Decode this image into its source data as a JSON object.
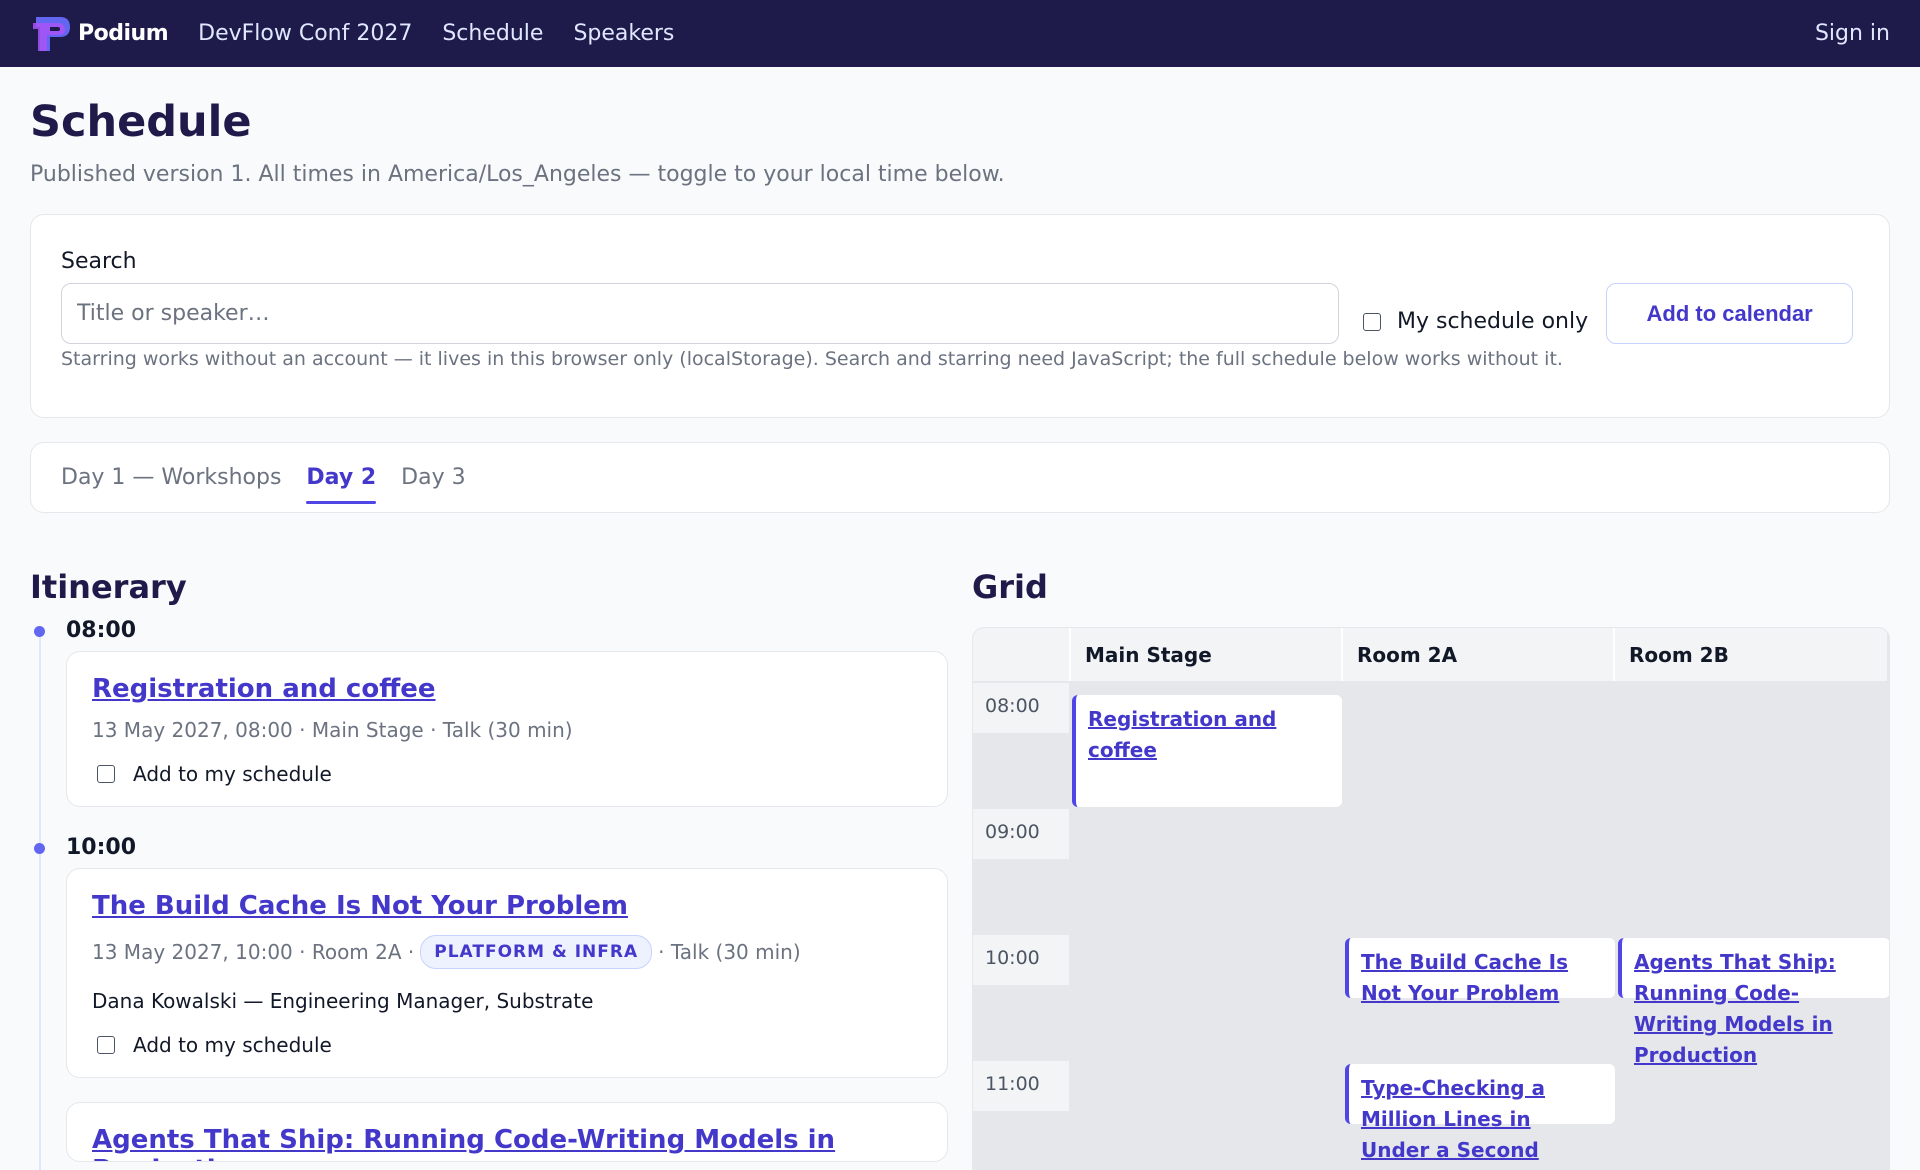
{
  "nav": {
    "brand": "Podium",
    "links": [
      "DevFlow Conf 2027",
      "Schedule",
      "Speakers"
    ],
    "sign_in": "Sign in"
  },
  "header": {
    "title": "Schedule",
    "subtitle": "Published version 1. All times in America/Los_Angeles — toggle to your local time below."
  },
  "search": {
    "label": "Search",
    "placeholder": "Title or speaker…",
    "mine_only_label": "My schedule only",
    "add_calendar_label": "Add to calendar",
    "hint": "Starring works without an account — it lives in this browser only (localStorage). Search and starring need JavaScript; the full schedule below works without it."
  },
  "days": {
    "tabs": [
      "Day 1 — Workshops",
      "Day 2",
      "Day 3"
    ],
    "active": "Day 2"
  },
  "itinerary": {
    "title": "Itinerary",
    "add_label": "Add to my schedule",
    "slots": [
      {
        "time": "08:00",
        "sessions": [
          {
            "title": "Registration and coffee",
            "meta": "13 May 2027, 08:00 · Main Stage · Talk (30 min)"
          }
        ]
      },
      {
        "time": "10:00",
        "sessions": [
          {
            "title": "The Build Cache Is Not Your Problem",
            "meta_before": "13 May 2027, 10:00 · Room 2A ·",
            "track": "PLATFORM & INFRA",
            "meta_after": "· Talk (30 min)",
            "speaker": "Dana Kowalski — Engineering Manager, Substrate"
          },
          {
            "title": "Agents That Ship: Running Code-Writing Models in Production"
          }
        ]
      }
    ]
  },
  "grid": {
    "title": "Grid",
    "rooms": [
      "Main Stage",
      "Room 2A",
      "Room 2B"
    ],
    "times": [
      "08:00",
      "09:00",
      "10:00",
      "11:00"
    ],
    "sessions": [
      {
        "title": "Registration and coffee",
        "room": "Main Stage",
        "start": "08:00"
      },
      {
        "title": "The Build Cache Is Not Your Problem",
        "room": "Room 2A",
        "start": "10:00"
      },
      {
        "title": "Agents That Ship: Running Code-Writing Models in Production",
        "room": "Room 2B",
        "start": "10:00"
      },
      {
        "title": "Type-Checking a Million Lines in Under a Second",
        "room": "Room 2A",
        "start": "11:00"
      }
    ]
  },
  "colors": {
    "nav_bg": "#1e1b4b",
    "accent": "#4338ca",
    "accent_bar": "#4f46e5"
  }
}
